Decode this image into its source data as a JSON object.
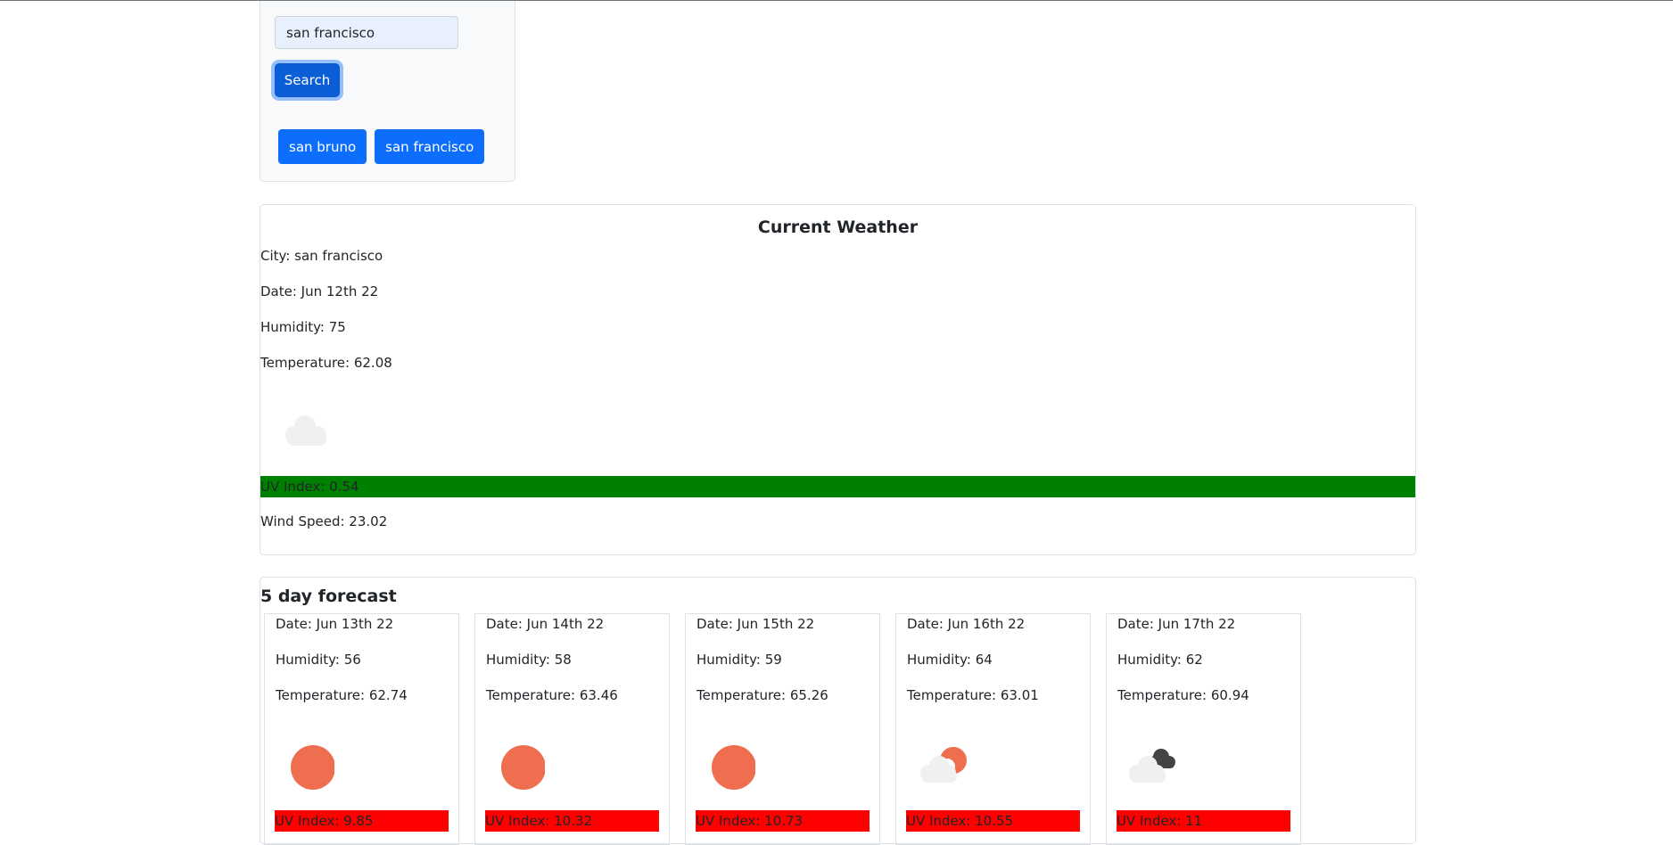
{
  "search": {
    "input_value": "san francisco",
    "button_label": "Search",
    "history": [
      "san bruno",
      "san francisco"
    ]
  },
  "current": {
    "title": "Current Weather",
    "city": "City: san francisco",
    "date": "Date: Jun 12th 22",
    "humidity": "Humidity: 75",
    "temperature": "Temperature: 62.08",
    "icon": "cloud-icon",
    "uv": "UV Index: 0.54",
    "uv_color": "#008000",
    "wind": "Wind Speed: 23.02"
  },
  "forecast": {
    "title": "5 day forecast",
    "days": [
      {
        "date": "Date: Jun 13th 22",
        "humidity": "Humidity: 56",
        "temperature": "Temperature: 62.74",
        "icon": "sun-icon",
        "uv": "UV Index: 9.85"
      },
      {
        "date": "Date: Jun 14th 22",
        "humidity": "Humidity: 58",
        "temperature": "Temperature: 63.46",
        "icon": "sun-icon",
        "uv": "UV Index: 10.32"
      },
      {
        "date": "Date: Jun 15th 22",
        "humidity": "Humidity: 59",
        "temperature": "Temperature: 65.26",
        "icon": "sun-icon",
        "uv": "UV Index: 10.73"
      },
      {
        "date": "Date: Jun 16th 22",
        "humidity": "Humidity: 64",
        "temperature": "Temperature: 63.01",
        "icon": "partly-cloudy-icon",
        "uv": "UV Index: 10.55"
      },
      {
        "date": "Date: Jun 17th 22",
        "humidity": "Humidity: 62",
        "temperature": "Temperature: 60.94",
        "icon": "cloudy-icon",
        "uv": "UV Index: 11"
      }
    ],
    "uv_color": "#ff0000"
  }
}
